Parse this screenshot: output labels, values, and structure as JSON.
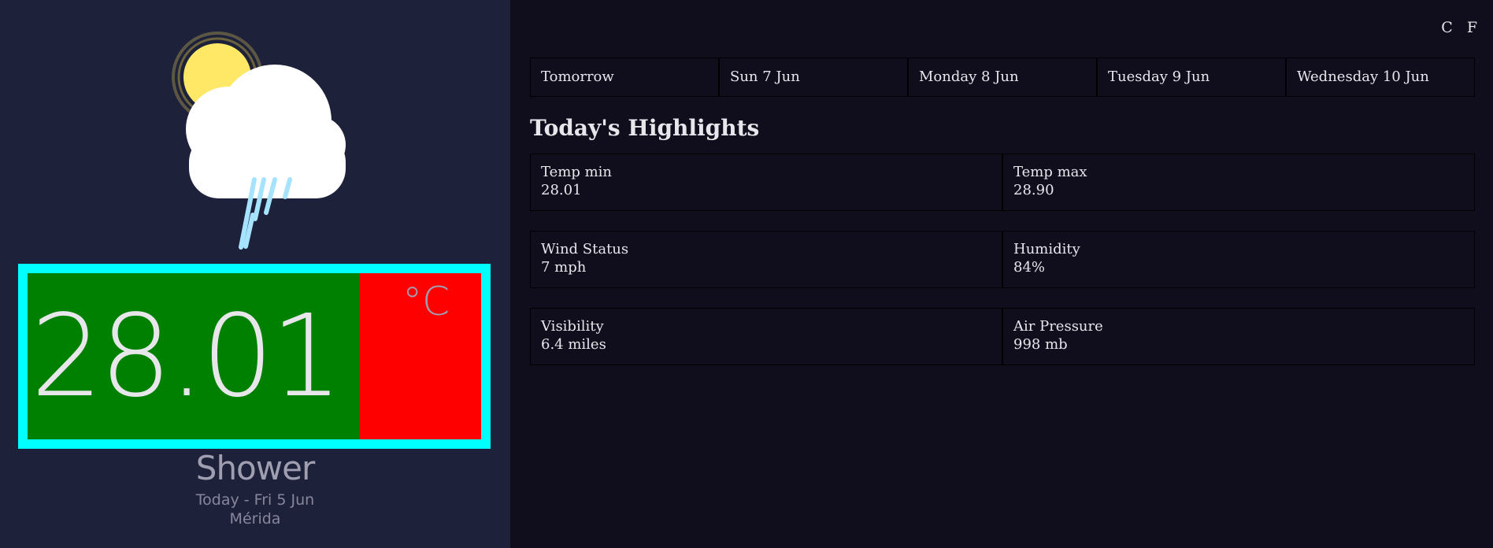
{
  "current": {
    "temp": "28.01",
    "unit": "°C",
    "condition": "Shower",
    "date": "Today - Fri 5 Jun",
    "location": "Mérida",
    "icon": "shower-icon"
  },
  "units": {
    "celsius": "C",
    "fahrenheit": "F"
  },
  "forecast": [
    {
      "label": "Tomorrow"
    },
    {
      "label": "Sun 7 Jun"
    },
    {
      "label": "Monday 8 Jun"
    },
    {
      "label": "Tuesday 9 Jun"
    },
    {
      "label": "Wednesday 10 Jun"
    }
  ],
  "highlights": {
    "title": "Today's Highlights",
    "rows": [
      [
        {
          "label": "Temp min",
          "value": "28.01"
        },
        {
          "label": "Temp max",
          "value": "28.90"
        }
      ],
      [
        {
          "label": "Wind Status",
          "value": "7 mph"
        },
        {
          "label": "Humidity",
          "value": "84%"
        }
      ],
      [
        {
          "label": "Visibility",
          "value": "6.4 miles"
        },
        {
          "label": "Air Pressure",
          "value": "998 mb"
        }
      ]
    ]
  },
  "colors": {
    "sidebar_bg": "#1e213a",
    "main_bg": "#100e1d",
    "temp_border": "#00ffff",
    "temp_value_bg": "#008000",
    "temp_unit_bg": "#ff0000",
    "sun": "#ffe866",
    "rain": "#a6e3ff"
  }
}
